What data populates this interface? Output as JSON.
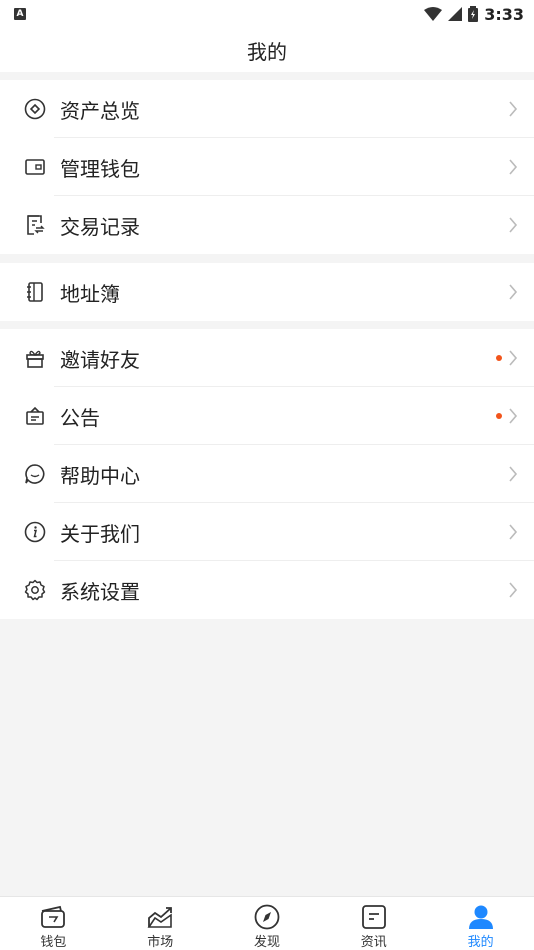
{
  "status_bar": {
    "app_badge": "A",
    "time": "3:33",
    "icons": [
      "wifi-icon",
      "cell-signal-icon",
      "battery-icon"
    ]
  },
  "header": {
    "title": "我的"
  },
  "groups": [
    {
      "items": [
        {
          "label": "资产总览",
          "icon": "asset-overview-icon",
          "dot": false
        },
        {
          "label": "管理钱包",
          "icon": "wallet-icon",
          "dot": false
        },
        {
          "label": "交易记录",
          "icon": "transaction-record-icon",
          "dot": false
        }
      ]
    },
    {
      "items": [
        {
          "label": "地址簿",
          "icon": "address-book-icon",
          "dot": false
        }
      ]
    },
    {
      "items": [
        {
          "label": "邀请好友",
          "icon": "gift-icon",
          "dot": true
        },
        {
          "label": "公告",
          "icon": "announcement-icon",
          "dot": true
        },
        {
          "label": "帮助中心",
          "icon": "help-chat-icon",
          "dot": false
        },
        {
          "label": "关于我们",
          "icon": "info-icon",
          "dot": false
        },
        {
          "label": "系统设置",
          "icon": "settings-gear-icon",
          "dot": false
        }
      ]
    }
  ],
  "tabbar": {
    "tabs": [
      {
        "label": "钱包",
        "icon": "wallet-tab-icon",
        "active": false
      },
      {
        "label": "市场",
        "icon": "market-chart-icon",
        "active": false
      },
      {
        "label": "发现",
        "icon": "compass-icon",
        "active": false
      },
      {
        "label": "资讯",
        "icon": "news-icon",
        "active": false
      },
      {
        "label": "我的",
        "icon": "user-icon",
        "active": true
      }
    ]
  },
  "colors": {
    "accent": "#1e88ff",
    "badge_dot": "#f2541b",
    "background": "#f4f4f4"
  }
}
